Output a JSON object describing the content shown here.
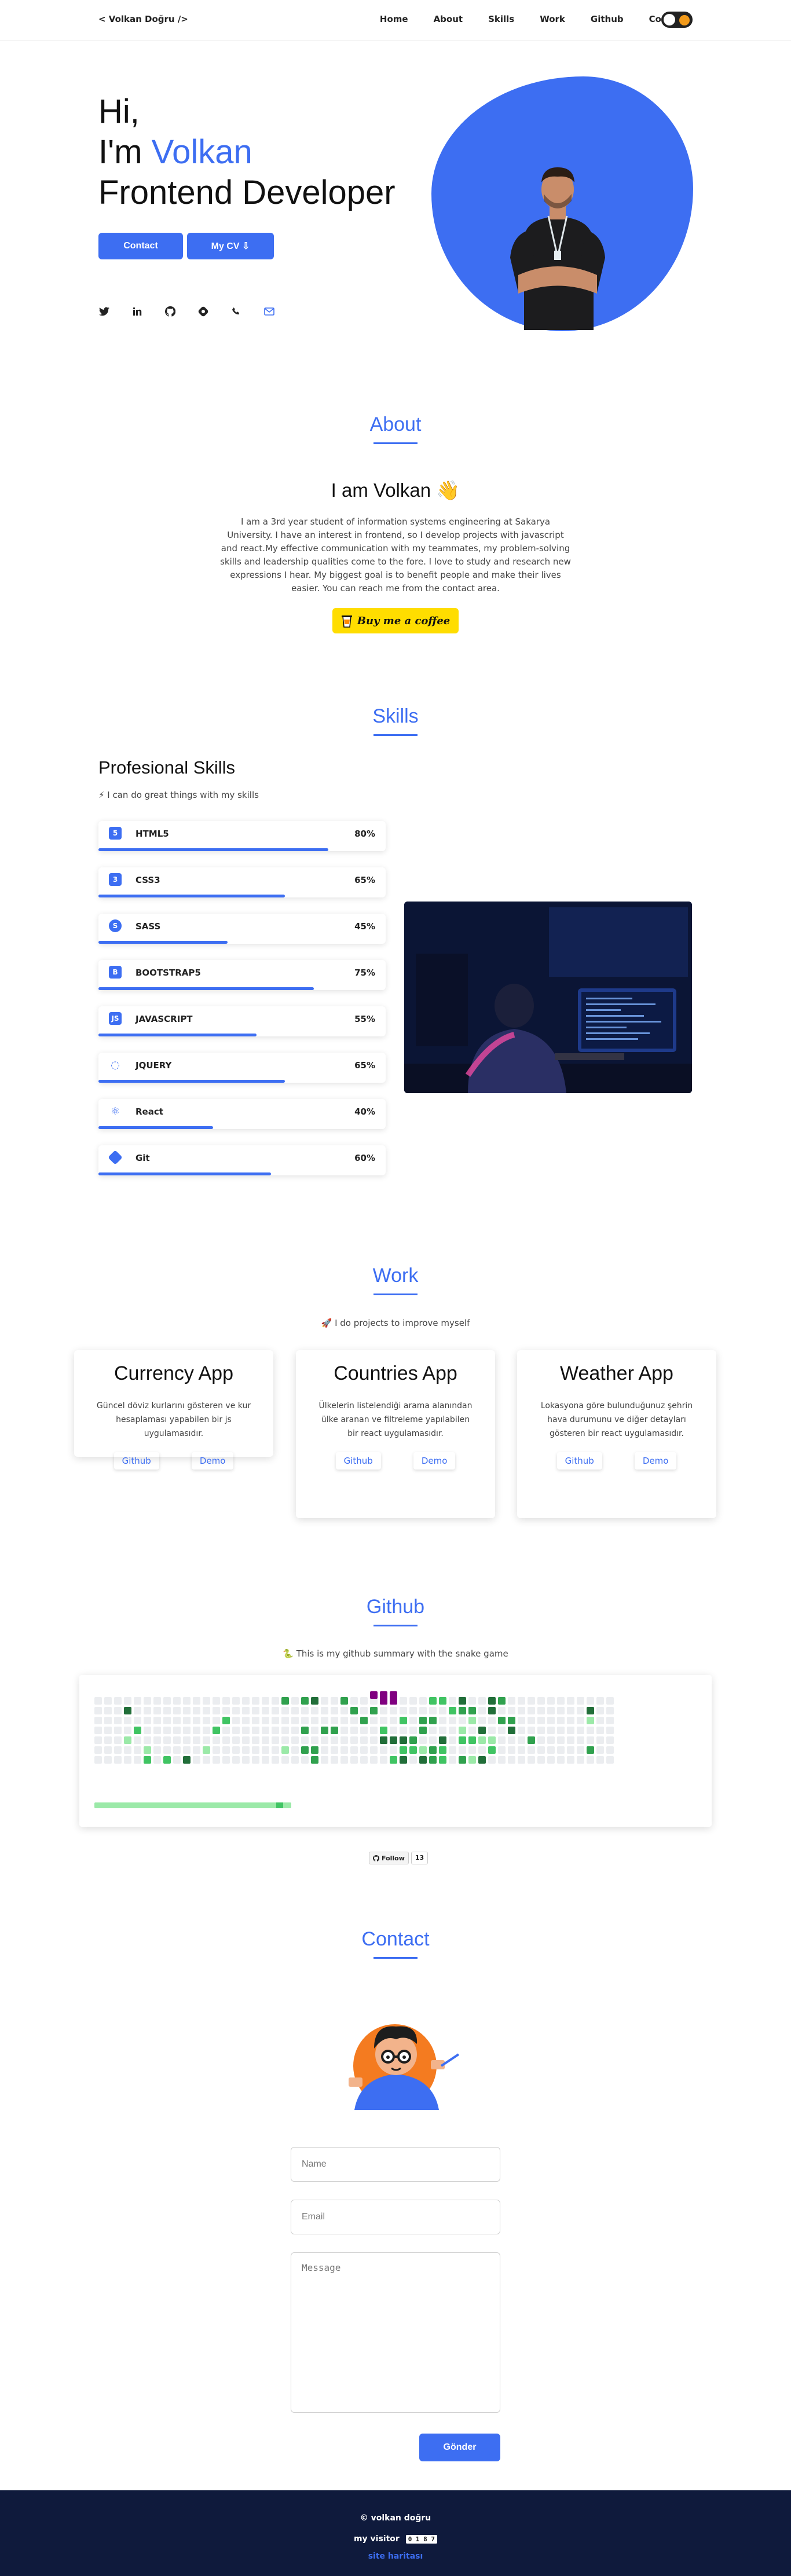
{
  "nav": {
    "logo": "< Volkan Doğru />",
    "items": [
      "Home",
      "About",
      "Skills",
      "Work",
      "Github",
      "Contact"
    ]
  },
  "hero": {
    "greeting": "Hi,",
    "im": "I'm",
    "name": "Volkan",
    "role": "Frontend Developer",
    "contact_button": "Contact",
    "cv_button": "My CV ⇩",
    "social_icons": [
      "twitter-icon",
      "linkedin-icon",
      "github-icon",
      "hashnode-icon",
      "phone-icon",
      "mail-icon"
    ]
  },
  "about": {
    "title": "About",
    "heading": "I am Volkan 👋",
    "text": "I am a 3rd year student of information systems engineering at Sakarya University. I have an interest in frontend, so I develop projects with javascript and react.My effective communication with my teammates, my problem-solving skills and leadership qualities come to the fore. I love to study and research new expressions I hear. My biggest goal is to benefit people and make their lives easier. You can reach me from the contact area.",
    "coffee_button": "Buy me a coffee"
  },
  "skills": {
    "title": "Skills",
    "heading": "Profesional Skills",
    "subtitle": "⚡ I can do great things with my skills",
    "items": [
      {
        "name": "HTML5",
        "percent": "80%",
        "value": 80
      },
      {
        "name": "CSS3",
        "percent": "65%",
        "value": 65
      },
      {
        "name": "SASS",
        "percent": "45%",
        "value": 45
      },
      {
        "name": "BOOTSTRAP5",
        "percent": "75%",
        "value": 75
      },
      {
        "name": "JAVASCRIPT",
        "percent": "55%",
        "value": 55
      },
      {
        "name": "JQUERY",
        "percent": "65%",
        "value": 65
      },
      {
        "name": "React",
        "percent": "40%",
        "value": 40
      },
      {
        "name": "Git",
        "percent": "60%",
        "value": 60
      }
    ]
  },
  "work": {
    "title": "Work",
    "subtitle": "🚀 I do projects to improve myself",
    "projects": [
      {
        "title": "Currency App",
        "desc": "Güncel döviz kurlarını gösteren ve kur hesaplaması yapabilen bir js uygulamasıdır.",
        "github": "Github",
        "demo": "Demo"
      },
      {
        "title": "Countries App",
        "desc": "Ülkelerin listelendiği arama alanından ülke aranan ve filtreleme yapılabilen bir react uygulamasıdır.",
        "github": "Github",
        "demo": "Demo"
      },
      {
        "title": "Weather App",
        "desc": "Lokasyona göre bulunduğunuz şehrin hava durumunu ve diğer detayları gösteren bir react uygulamasıdır.",
        "github": "Github",
        "demo": "Demo"
      }
    ]
  },
  "github": {
    "title": "Github",
    "subtitle": "🐍 This is my github summary with the snake game",
    "follow_label": "Follow",
    "follow_count": "13"
  },
  "contact": {
    "title": "Contact",
    "name_placeholder": "Name",
    "email_placeholder": "Email",
    "message_placeholder": "Message",
    "send_button": "Gönder"
  },
  "footer": {
    "copyright": "© volkan doğru",
    "visitor_label": "my visitor",
    "visitor_count": "0 1 8 7",
    "sitemap": "site haritası"
  },
  "colors": {
    "accent": "#3d6ef2",
    "footer": "#0f1a3c",
    "coffee": "#ffdd00"
  }
}
